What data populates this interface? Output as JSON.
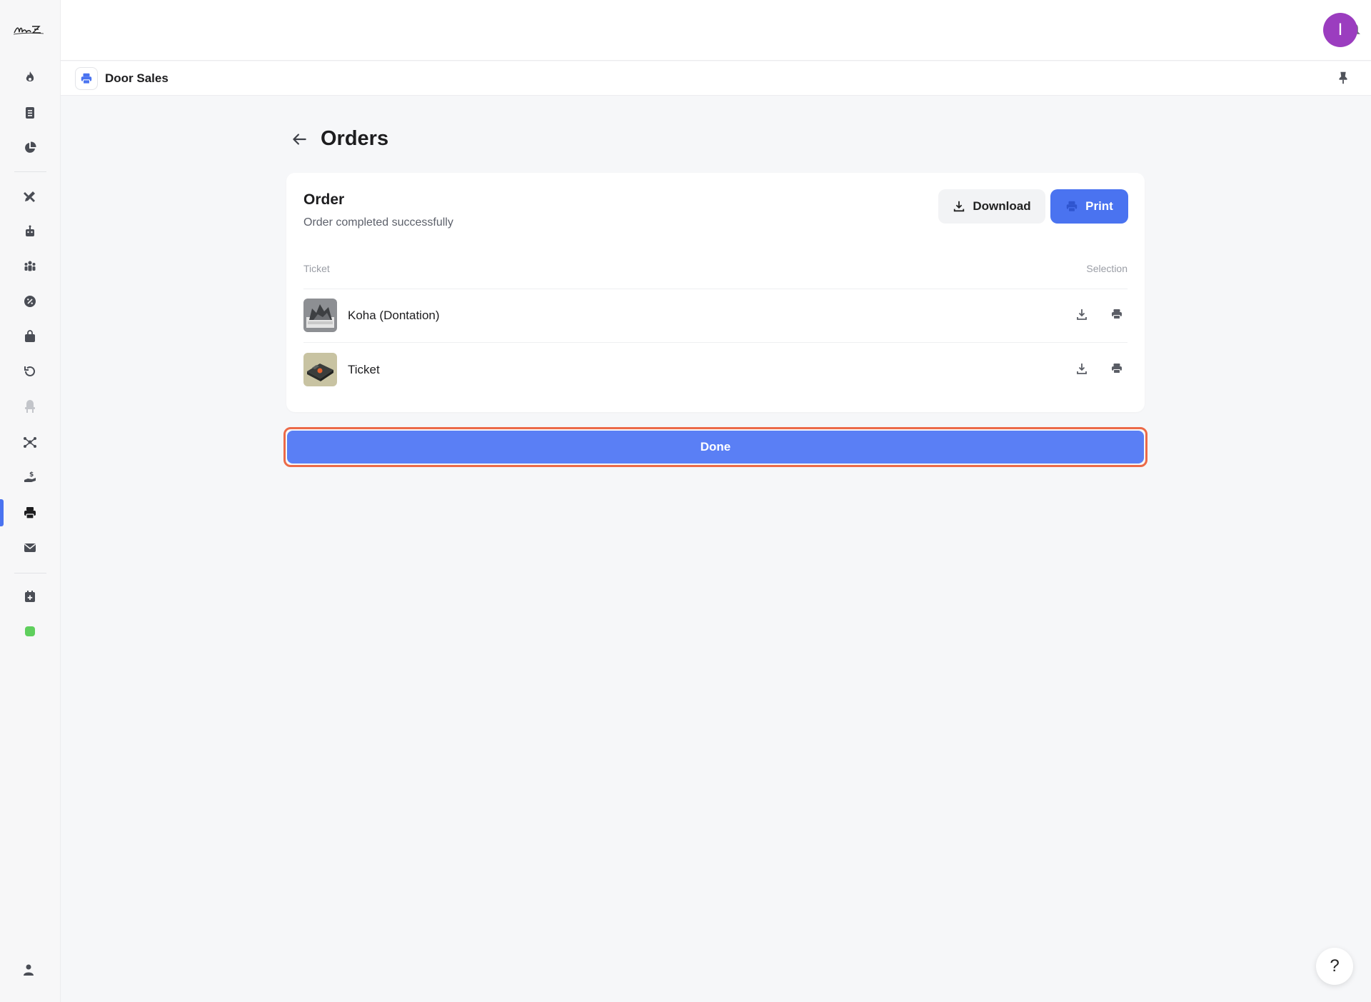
{
  "app": {
    "logo_text": "Noise Z"
  },
  "sidebar": {
    "items": [
      {
        "icon": "flame-icon"
      },
      {
        "icon": "document-icon"
      },
      {
        "icon": "pie-chart-icon"
      },
      {
        "icon": "pen-ruler-icon"
      },
      {
        "icon": "robot-icon"
      },
      {
        "icon": "people-icon"
      },
      {
        "icon": "percent-badge-icon"
      },
      {
        "icon": "bag-icon"
      },
      {
        "icon": "refresh-icon"
      },
      {
        "icon": "seat-icon"
      },
      {
        "icon": "network-icon"
      },
      {
        "icon": "hand-dollar-icon"
      },
      {
        "icon": "printer-icon",
        "active": true
      },
      {
        "icon": "mail-icon"
      },
      {
        "icon": "calendar-plus-icon"
      }
    ],
    "accent_color": "#4a73f0",
    "status_color": "#5fcf5d"
  },
  "topbar": {
    "avatar_initial": "I",
    "avatar_color": "#9b3dbf"
  },
  "subheader": {
    "title": "Door Sales"
  },
  "main": {
    "page_title": "Orders",
    "card": {
      "title": "Order",
      "subtitle": "Order completed successfully",
      "download_label": "Download",
      "print_label": "Print",
      "columns": {
        "ticket": "Ticket",
        "selection": "Selection"
      },
      "rows": [
        {
          "label": "Koha (Dontation)"
        },
        {
          "label": "Ticket"
        }
      ]
    },
    "done_label": "Done"
  },
  "help": {
    "label": "?"
  }
}
